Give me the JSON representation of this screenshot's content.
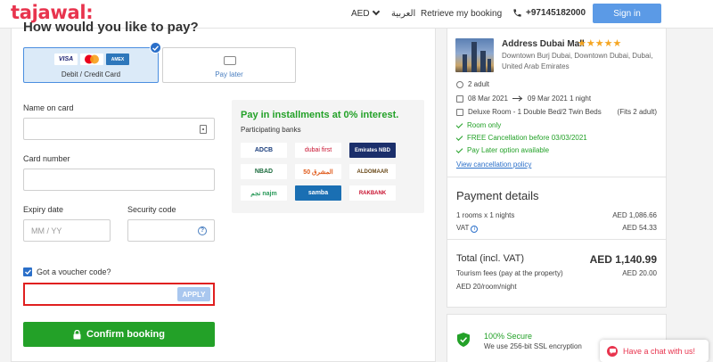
{
  "header": {
    "logo": "tajawal:",
    "currency": "AED",
    "language": "العربية",
    "retrieve": "Retrieve my booking",
    "phone": "+97145182000",
    "signin": "Sign in"
  },
  "payment": {
    "title": "How would you like to pay?",
    "card_option": {
      "label": "Debit / Credit Card",
      "logos": [
        "VISA",
        "Mastercard",
        "AMEX"
      ],
      "selected": true
    },
    "later_option": {
      "label": "Pay later"
    },
    "name_label": "Name on card",
    "name_value": "",
    "card_label": "Card number",
    "card_value": "",
    "expiry_label": "Expiry date",
    "expiry_placeholder": "MM / YY",
    "security_label": "Security code",
    "security_value": "",
    "voucher_label": "Got a voucher code?",
    "voucher_checked": true,
    "voucher_value": "",
    "apply_label": "APPLY",
    "confirm_label": "Confirm booking"
  },
  "installments": {
    "title": "Pay in installments at 0% interest.",
    "subtitle": "Participating banks",
    "banks": [
      "ADCB",
      "dubai first",
      "Emirates NBD",
      "NBAD",
      "المشرق 50",
      "ALDOMAAR",
      "نجم najm",
      "samba",
      "RAKBANK"
    ]
  },
  "booking": {
    "hotel_name": "Address Dubai Mall",
    "stars": "★★★★★",
    "address_line1": "Downtown Burj Dubai, Downtown Dubai, Dubai,",
    "address_line2": "United Arab Emirates",
    "guests": "2 adult",
    "checkin": "08 Mar 2021",
    "checkout": "09 Mar 2021 1 night",
    "room": "Deluxe Room - 1 Double Bed/2 Twin Beds",
    "fits": "(Fits 2 adult)",
    "perks": [
      "Room only",
      "FREE Cancellation before 03/03/2021",
      "Pay Later option available"
    ],
    "policy_link": "View cancellation policy"
  },
  "payment_details": {
    "title": "Payment details",
    "rooms_label": "1 rooms x 1 nights",
    "rooms_amount": "AED 1,086.66",
    "vat_label": "VAT",
    "vat_amount": "AED 54.33",
    "total_label": "Total (incl. VAT)",
    "total_amount": "AED 1,140.99",
    "tourism_label": "Tourism fees (pay at the property)",
    "tourism_amount": "AED 20.00",
    "tourism_rate": "AED 20/room/night"
  },
  "secure": {
    "title": "100% Secure",
    "subtitle": "We use 256-bit SSL encryption"
  },
  "chat": {
    "label": "Have a chat with us!"
  },
  "colors": {
    "brand": "#e8344e",
    "primary": "#2a6fc9",
    "success": "#23a128",
    "error": "#e02020"
  }
}
